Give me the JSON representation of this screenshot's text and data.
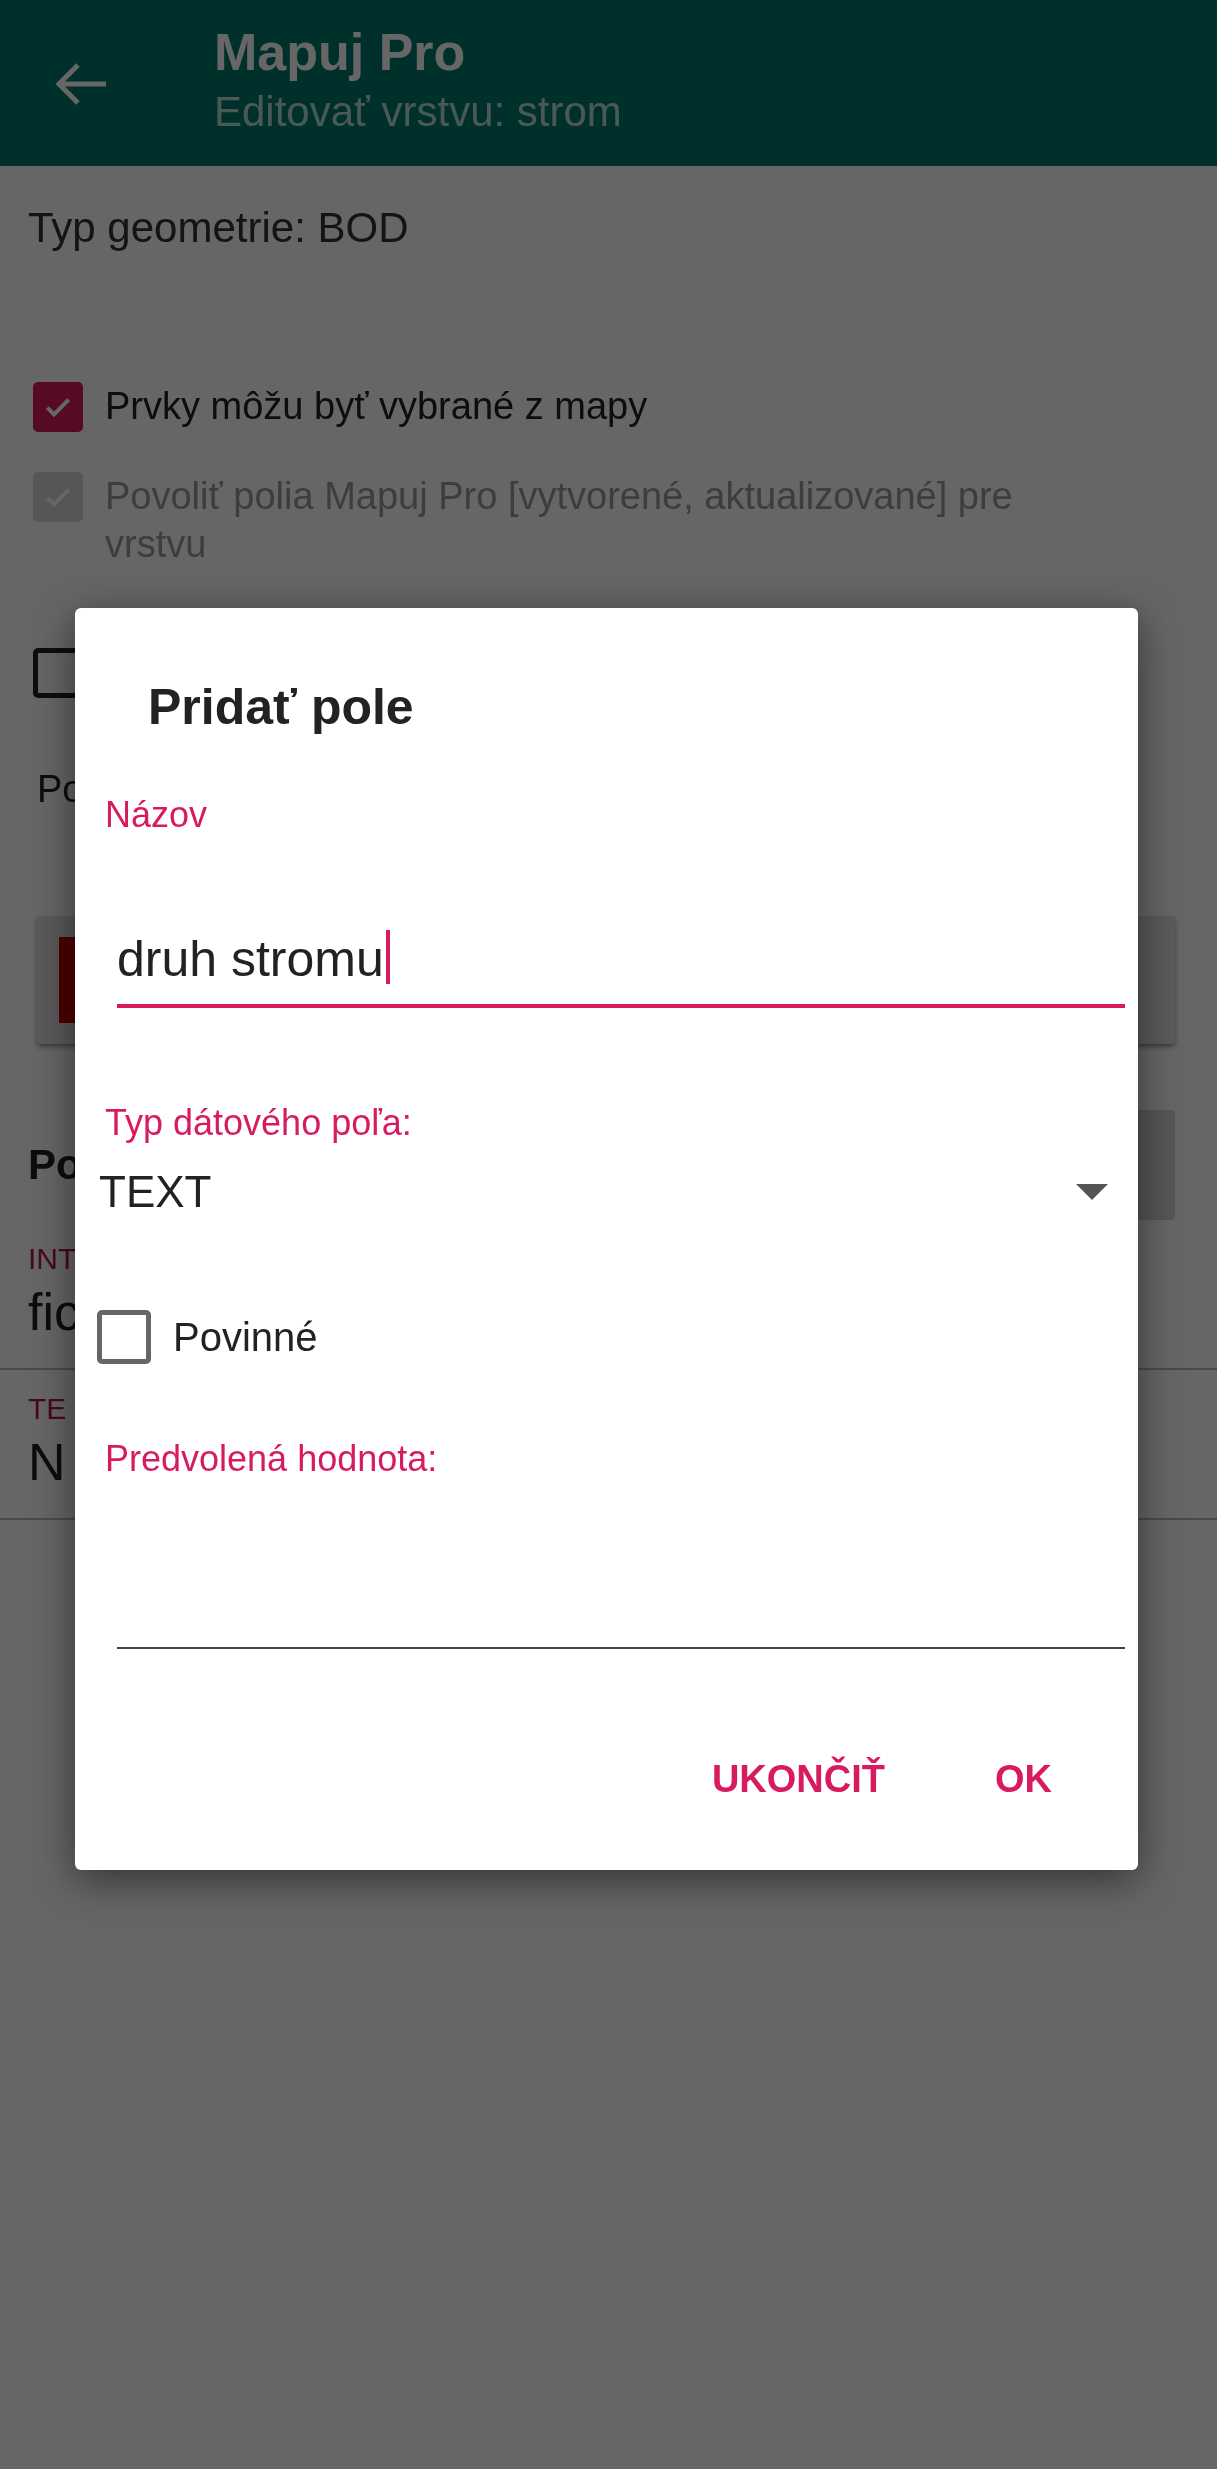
{
  "app_bar": {
    "title": "Mapuj Pro",
    "subtitle": "Editovať vrstvu: strom"
  },
  "layer": {
    "geometry": "Typ geometrie: BOD",
    "options": [
      {
        "label": "Prvky môžu byť vybrané z mapy",
        "checked": true,
        "disabled": false
      },
      {
        "label": "Povoliť polia Mapuj Pro [vytvorené, aktualizované] pre vrstvu",
        "checked": true,
        "disabled": true
      },
      {
        "checked": false,
        "disabled": false
      }
    ],
    "style_label": "Po",
    "fields_heading": "Po",
    "fields": [
      {
        "type": "INT",
        "name": "fic"
      },
      {
        "type": "TE",
        "name": "N"
      }
    ]
  },
  "dialog": {
    "title": "Pridať pole",
    "name_field": {
      "label": "Názov",
      "value": "druh stromu"
    },
    "type_field": {
      "label": "Typ dátového poľa:",
      "value": "TEXT"
    },
    "required": {
      "label": "Povinné",
      "checked": false
    },
    "default_field": {
      "label": "Predvolená hodnota:"
    },
    "buttons": [
      "UKONČIŤ",
      "OK"
    ]
  }
}
